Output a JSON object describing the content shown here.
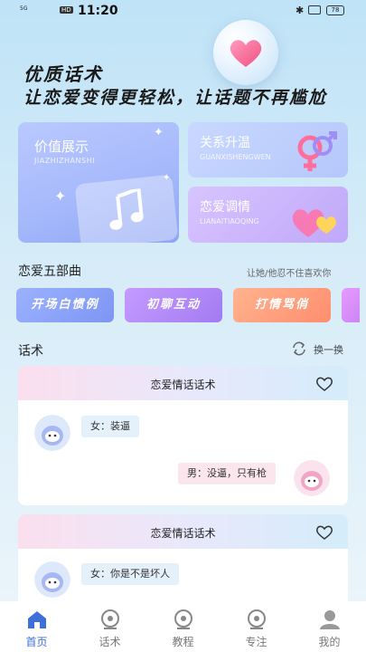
{
  "status_bar": {
    "signal": "5G",
    "network_badge": "HD",
    "time": "11:20",
    "battery": "78"
  },
  "hero": {
    "title": "优质话术",
    "subtitle": "让恋爱变得更轻松，让话题不再尴尬"
  },
  "features": [
    {
      "title": "价值展示",
      "subtitle": "JIAZHIZHANSHI"
    },
    {
      "title": "关系升温",
      "subtitle": "GUANXISHENGWEN"
    },
    {
      "title": "恋爱调情",
      "subtitle": "LIANAITIAOQING"
    }
  ],
  "section_five": {
    "title": "恋爱五部曲",
    "tagline": "让她/他忍不住喜欢你",
    "chips": [
      "开场白惯例",
      "初聊互动",
      "打情骂俏",
      ""
    ]
  },
  "section_talk": {
    "title": "话术",
    "refresh_label": "换一换"
  },
  "talk_cards": [
    {
      "title": "恋爱情话话术",
      "female_line": "女：装逼",
      "male_line": "男：没逼，只有枪"
    },
    {
      "title": "恋爱情话话术",
      "female_line": "女：你是不是坏人"
    }
  ],
  "tabbar": {
    "items": [
      {
        "label": "首页",
        "icon": "home-icon",
        "active": true
      },
      {
        "label": "话术",
        "icon": "chat-icon",
        "active": false
      },
      {
        "label": "教程",
        "icon": "course-icon",
        "active": false
      },
      {
        "label": "专注",
        "icon": "focus-icon",
        "active": false
      },
      {
        "label": "我的",
        "icon": "profile-icon",
        "active": false
      }
    ]
  },
  "colors": {
    "accent": "#3f6fd8",
    "chip1": "#8aa2f8",
    "chip2": "#b48af6",
    "chip3": "#ff9d7c"
  }
}
